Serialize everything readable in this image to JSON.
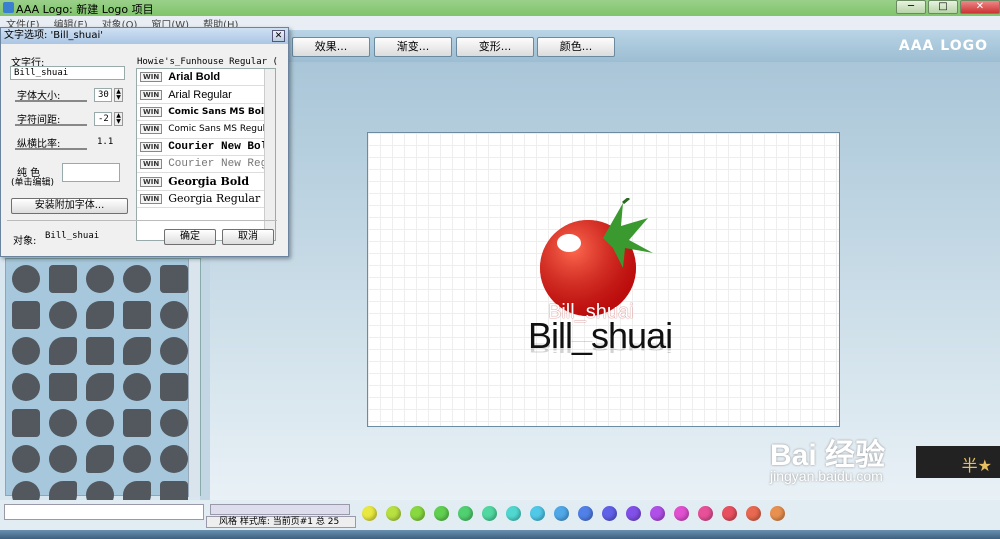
{
  "window": {
    "title": "AAA Logo: 新建 Logo 项目",
    "min": "─",
    "max": "□",
    "close": "✕"
  },
  "menu": [
    "文件(F)",
    "编辑(E)",
    "对象(O)",
    "窗口(W)",
    "帮助(H)"
  ],
  "toolbar": {
    "buttons": [
      "效果...",
      "渐变...",
      "变形...",
      "颜色..."
    ],
    "brand": "AAA LOGO"
  },
  "dialog": {
    "title": "文字选项: 'Bill_shuai'",
    "text_label": "文字行:",
    "text_value": "Bill_shuai",
    "size_label": "字体大小:",
    "size_value": "30",
    "spacing_label": "字符间距:",
    "spacing_value": "-2",
    "ratio_label": "纵横比率:",
    "ratio_value": "1.1",
    "color_label_1": "纯 色",
    "color_label_2": "(单击编辑)",
    "install_button": "安装附加字体...",
    "object_label": "对象:",
    "object_value": "Bill_shuai",
    "ok": "确定",
    "cancel": "取消",
    "preview": "Howie's_Funhouse Regular (Howie",
    "fonts": [
      {
        "tag": "WIN",
        "name": "Arial Bold"
      },
      {
        "tag": "WIN",
        "name": "Arial Regular"
      },
      {
        "tag": "WIN",
        "name": "Comic Sans MS Bold"
      },
      {
        "tag": "WIN",
        "name": "Comic Sans MS Regular"
      },
      {
        "tag": "WIN",
        "name": "Courier New Bold"
      },
      {
        "tag": "WIN",
        "name": "Courier New Regular"
      },
      {
        "tag": "WIN",
        "name": "Georgia Bold"
      },
      {
        "tag": "WIN",
        "name": "Georgia Regular"
      }
    ]
  },
  "logo": {
    "line1": "Bill_shuai",
    "line2": "Bill_shuai"
  },
  "status": {
    "style_info": "风格 样式库: 当前页#1 总 25"
  },
  "swatches": [
    "#e8e840",
    "#b8e040",
    "#88d840",
    "#60d050",
    "#50d070",
    "#50d8a0",
    "#50d8d0",
    "#50c8e8",
    "#50a8e8",
    "#5080e8",
    "#6060e8",
    "#8050e8",
    "#b050e8",
    "#e050d0",
    "#e85098",
    "#e85060",
    "#e86850",
    "#e89050"
  ],
  "watermark": {
    "text": "Bai 经验",
    "url": "jingyan.baidu.com",
    "badge": "半★"
  }
}
